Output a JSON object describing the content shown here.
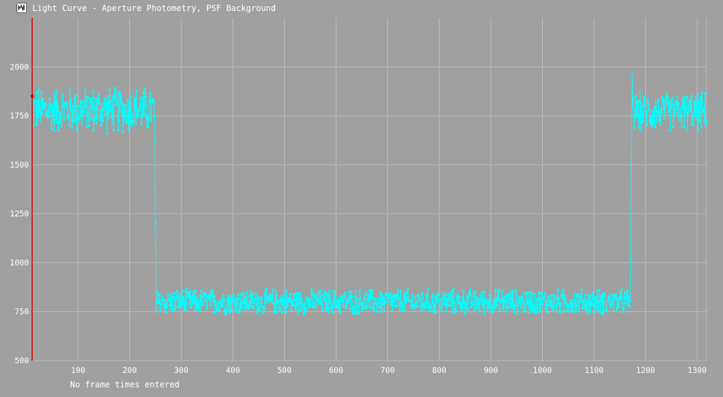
{
  "window": {
    "title": "Light Curve - Aperture Photometry, PSF Background"
  },
  "status": {
    "text": "No frame times entered"
  },
  "colors": {
    "background": "#a0a0a0",
    "grid": "#bdbdbd",
    "series": "#00ffff",
    "marker": "#cc0000"
  },
  "chart_data": {
    "type": "line",
    "title": "Light Curve - Aperture Photometry, PSF Background",
    "xlabel": "",
    "ylabel": "",
    "xlim": [
      10,
      1318
    ],
    "ylim": [
      500,
      2250
    ],
    "xticks": [
      100,
      200,
      300,
      400,
      500,
      600,
      700,
      800,
      900,
      1000,
      1100,
      1200,
      1300
    ],
    "yticks": [
      500,
      750,
      1000,
      1250,
      1500,
      1750,
      2000
    ],
    "grid": true,
    "legend": "none",
    "current_frame": 11,
    "current_value": 1850,
    "series": [
      {
        "x": [
          11,
          1318
        ],
        "segments": [
          {
            "from": 11,
            "to": 247,
            "level": 1780,
            "noise": 110
          },
          {
            "from": 248,
            "to": 251,
            "values": [
              1740,
              1620,
              1200,
              760
            ]
          },
          {
            "from": 252,
            "to": 1170,
            "level": 800,
            "noise": 60
          },
          {
            "from": 1171,
            "to": 1175,
            "values": [
              1020,
              1500,
              1750,
              1960,
              1800
            ]
          },
          {
            "from": 1176,
            "to": 1318,
            "level": 1770,
            "noise": 90
          }
        ],
        "min": 590,
        "max": 2070,
        "marker_style": "dot"
      }
    ]
  }
}
